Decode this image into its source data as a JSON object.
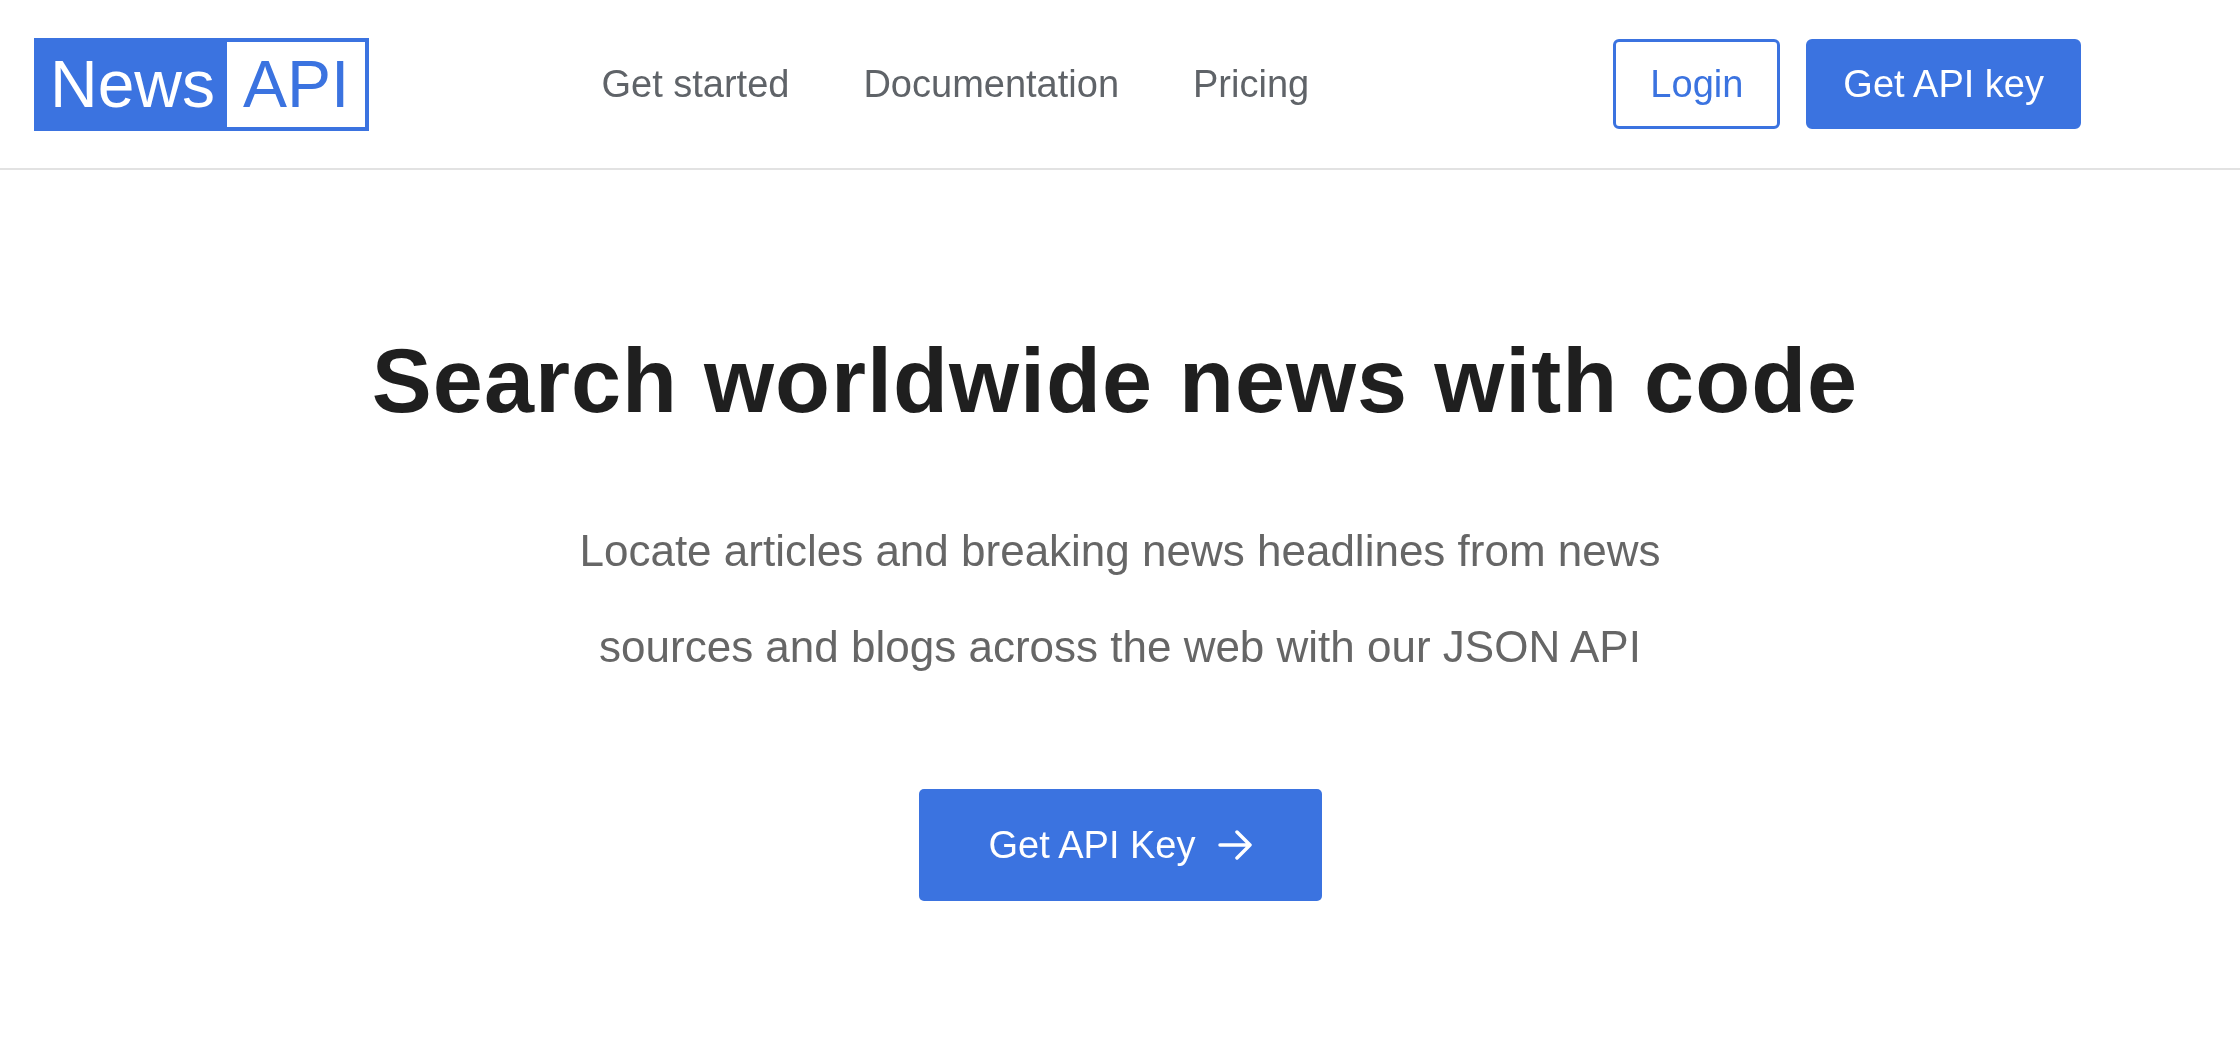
{
  "logo": {
    "word": "News",
    "boxed": "API"
  },
  "nav": [
    {
      "label": "Get started"
    },
    {
      "label": "Documentation"
    },
    {
      "label": "Pricing"
    }
  ],
  "login": "Login",
  "get_key": "Get API key",
  "hero": {
    "title": "Search worldwide news with code",
    "subtitle": "Locate articles and breaking news headlines from news sources and blogs across the web with our JSON API",
    "cta": "Get API Key"
  }
}
